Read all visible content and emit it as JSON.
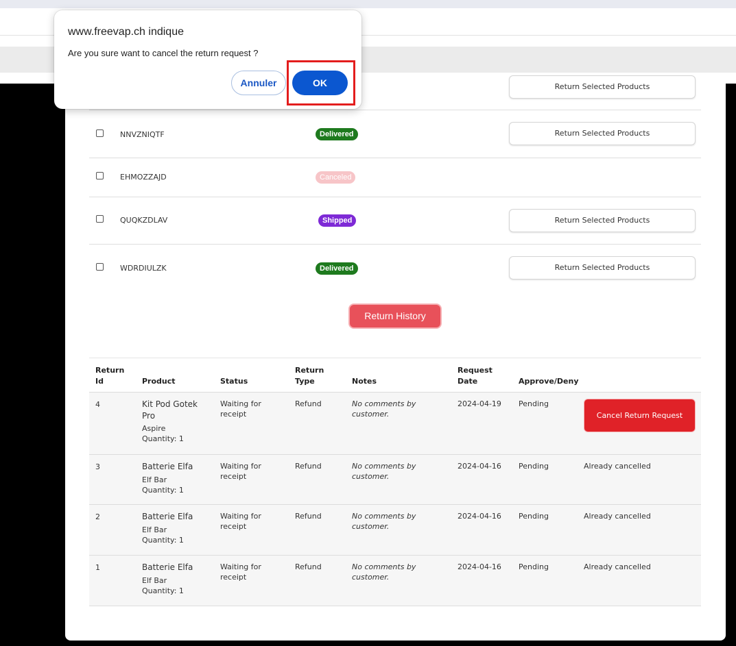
{
  "dialog": {
    "title": "www.freevap.ch indique",
    "message": "Are you sure want to cancel the return request ?",
    "cancel_label": "Annuler",
    "ok_label": "OK"
  },
  "orders": [
    {
      "id": "",
      "status": "",
      "action": "Return Selected Products"
    },
    {
      "id": "NNVZNIQTF",
      "status": "Delivered",
      "status_color": "#1e7a1e",
      "action": "Return Selected Products"
    },
    {
      "id": "EHMOZZAJD",
      "status": "Canceled",
      "status_color": "#f7c5c8",
      "action": ""
    },
    {
      "id": "QUQKZDLAV",
      "status": "Shipped",
      "status_color": "#7e2ad6",
      "action": "Return Selected Products"
    },
    {
      "id": "WDRDIULZK",
      "status": "Delivered",
      "status_color": "#1e7a1e",
      "action": "Return Selected Products"
    }
  ],
  "return_history_label": "Return History",
  "returns_table": {
    "headers": {
      "return_id": [
        "Return",
        "Id"
      ],
      "product": "Product",
      "status": "Status",
      "return_type": [
        "Return",
        "Type"
      ],
      "notes": "Notes",
      "request_date": [
        "Request",
        "Date"
      ],
      "approve_deny": "Approve/Deny"
    },
    "rows": [
      {
        "return_id": "4",
        "product_name": [
          "Kit Pod Gotek",
          "Pro"
        ],
        "brand": "Aspire",
        "quantity": "Quantity: 1",
        "status": [
          "Waiting for",
          "receipt"
        ],
        "return_type": "Refund",
        "notes": [
          "No comments by",
          "customer."
        ],
        "request_date": "2024-04-19",
        "approve_deny": "Pending",
        "action": [
          "Cancel Return",
          "Request"
        ],
        "action_is_button": true
      },
      {
        "return_id": "3",
        "product_name": [
          "Batterie Elfa",
          ""
        ],
        "brand": "Elf Bar",
        "quantity": "Quantity: 1",
        "status": [
          "Waiting for",
          "receipt"
        ],
        "return_type": "Refund",
        "notes": [
          "No comments by",
          "customer."
        ],
        "request_date": "2024-04-16",
        "approve_deny": "Pending",
        "action": [
          "Already cancelled",
          ""
        ],
        "action_is_button": false
      },
      {
        "return_id": "2",
        "product_name": [
          "Batterie Elfa",
          ""
        ],
        "brand": "Elf Bar",
        "quantity": "Quantity: 1",
        "status": [
          "Waiting for",
          "receipt"
        ],
        "return_type": "Refund",
        "notes": [
          "No comments by",
          "customer."
        ],
        "request_date": "2024-04-16",
        "approve_deny": "Pending",
        "action": [
          "Already cancelled",
          ""
        ],
        "action_is_button": false
      },
      {
        "return_id": "1",
        "product_name": [
          "Batterie Elfa",
          ""
        ],
        "brand": "Elf Bar",
        "quantity": "Quantity: 1",
        "status": [
          "Waiting for",
          "receipt"
        ],
        "return_type": "Refund",
        "notes": [
          "No comments by",
          "customer."
        ],
        "request_date": "2024-04-16",
        "approve_deny": "Pending",
        "action": [
          "Already cancelled",
          ""
        ],
        "action_is_button": false
      }
    ]
  },
  "colors": {
    "ok_button": "#0b57d0",
    "highlight_box": "#e31d1d",
    "cancel_return_button": "#e02228",
    "return_history_button": "#e8515a"
  }
}
